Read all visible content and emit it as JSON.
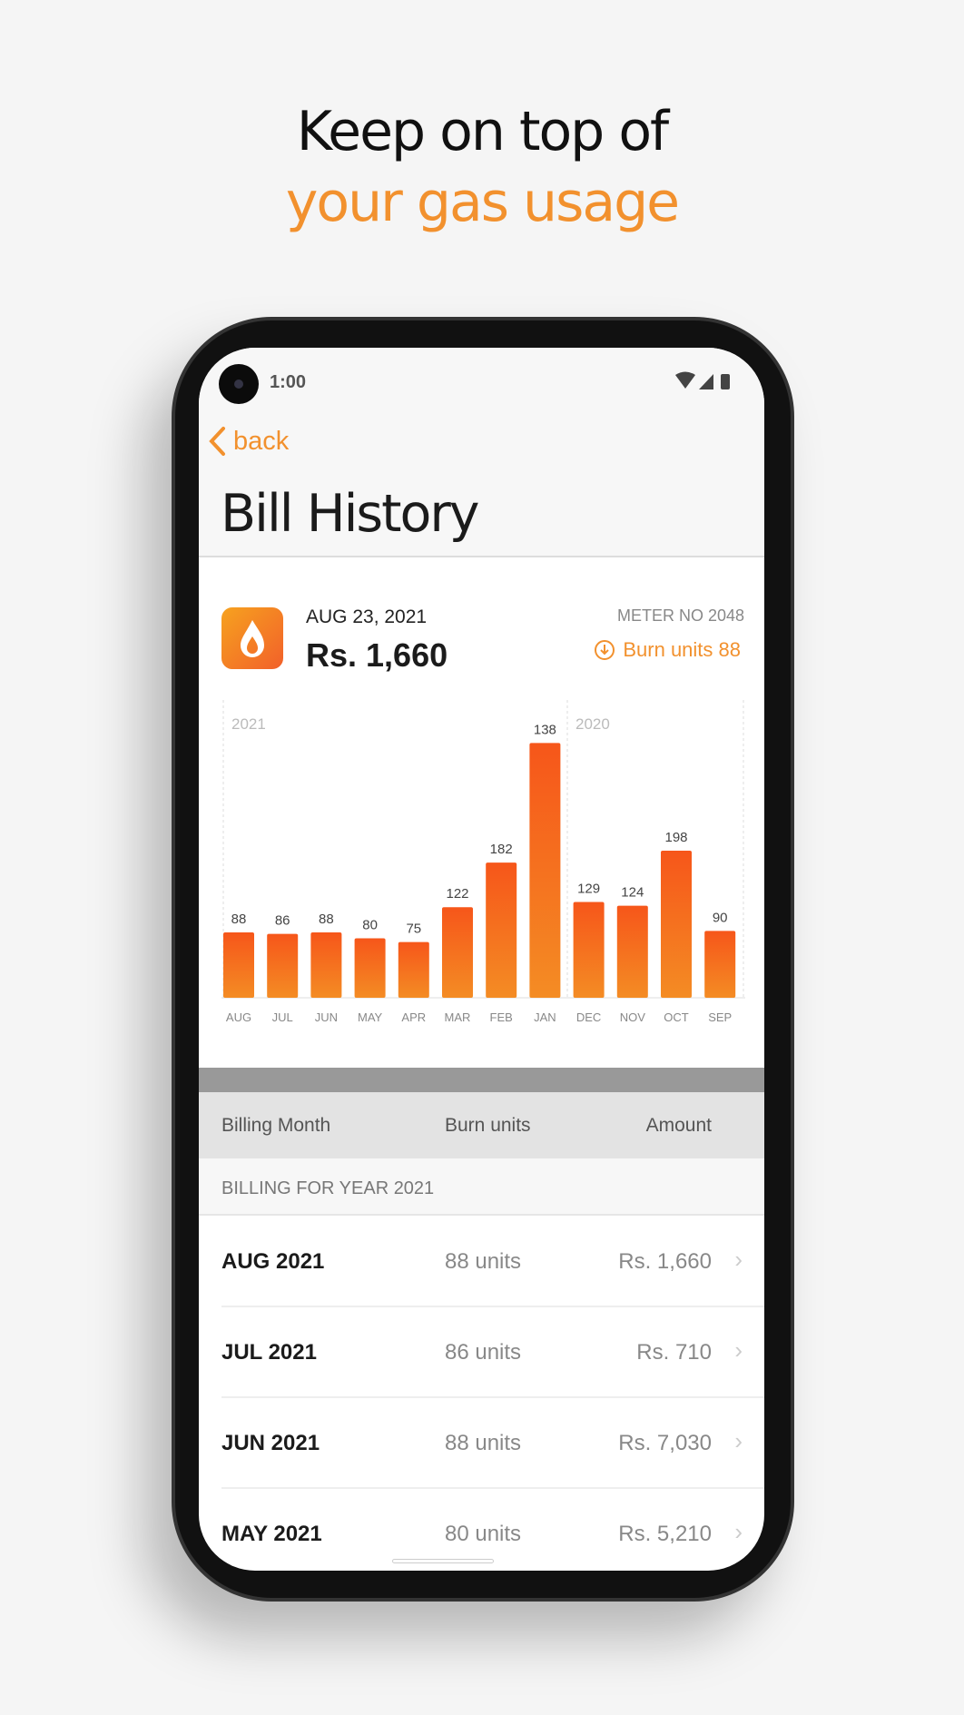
{
  "headline": {
    "line1": "Keep on top of",
    "line2": "your gas usage"
  },
  "status_bar": {
    "time": "1:00",
    "icons": [
      "wifi-icon",
      "signal-icon",
      "battery-icon"
    ]
  },
  "nav": {
    "back_label": "back",
    "title": "Bill History"
  },
  "summary": {
    "date": "AUG 23, 2021",
    "amount": "Rs. 1,660",
    "meter": "METER NO 2048",
    "burn_units": "Burn units 88",
    "icon": "flame-icon"
  },
  "colors": {
    "accent": "#f2912e",
    "bar_top": "#f6561a",
    "bar_bottom": "#f48c24"
  },
  "chart_data": {
    "type": "bar",
    "year_labels": [
      "2021",
      "2020"
    ],
    "categories": [
      "AUG",
      "JUL",
      "JUN",
      "MAY",
      "APR",
      "MAR",
      "FEB",
      "JAN",
      "DEC",
      "NOV",
      "OCT",
      "SEP"
    ],
    "values": [
      88,
      86,
      88,
      80,
      75,
      122,
      182,
      138,
      129,
      124,
      198,
      90
    ],
    "plotted_values": [
      88,
      86,
      88,
      80,
      75,
      122,
      182,
      343,
      129,
      124,
      198,
      90
    ],
    "grid": false
  },
  "table": {
    "headers": [
      "Billing Month",
      "Burn units",
      "Amount"
    ],
    "section": "BILLING FOR YEAR 2021",
    "rows": [
      {
        "month": "AUG 2021",
        "units": "88 units",
        "amount": "Rs. 1,660"
      },
      {
        "month": "JUL 2021",
        "units": "86 units",
        "amount": "Rs. 710"
      },
      {
        "month": "JUN 2021",
        "units": "88 units",
        "amount": "Rs. 7,030"
      },
      {
        "month": "MAY 2021",
        "units": "80 units",
        "amount": "Rs. 5,210"
      }
    ]
  }
}
